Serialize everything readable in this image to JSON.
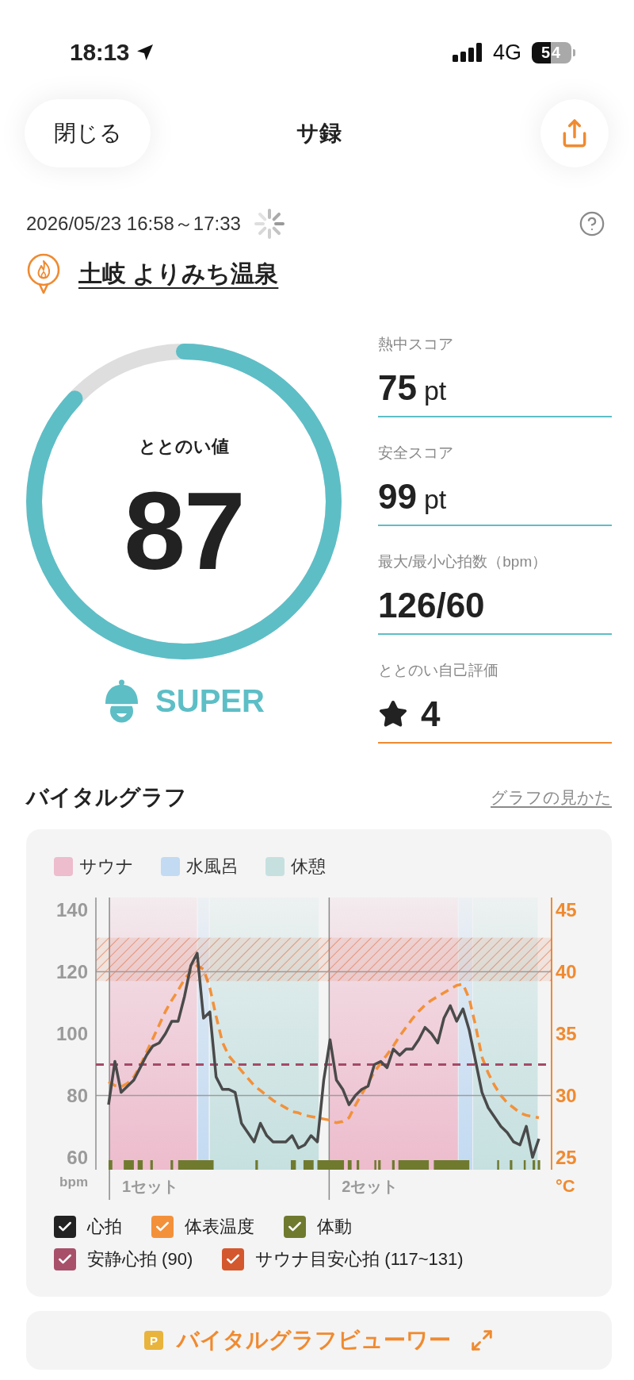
{
  "status_bar": {
    "time": "18:13",
    "network": "4G",
    "battery": "54"
  },
  "header": {
    "close_button": "閉じる",
    "title": "サ録"
  },
  "session": {
    "datetime": "2026/05/23 16:58～17:33",
    "place": "土岐 よりみち温泉"
  },
  "score": {
    "label": "ととのい値",
    "value": "87",
    "level": 0.87,
    "rank": "SUPER"
  },
  "stats": [
    {
      "kind": "metric",
      "label": "熱中スコア",
      "value": "75",
      "unit": "pt"
    },
    {
      "kind": "metric",
      "label": "安全スコア",
      "value": "99",
      "unit": "pt"
    },
    {
      "kind": "metric",
      "label": "最大/最小心拍数（bpm）",
      "value": "126/60"
    },
    {
      "kind": "rating",
      "label": "ととのい自己評価",
      "value": "4"
    }
  ],
  "vital_graph": {
    "title": "バイタルグラフ",
    "help_link": "グラフの見かた",
    "legend": [
      {
        "label": "サウナ",
        "color": "#edbccd"
      },
      {
        "label": "水風呂",
        "color": "#c2daf2"
      },
      {
        "label": "休憩",
        "color": "#c6e0e0"
      }
    ],
    "heart_rate_chart": {
      "chart_data": {
        "type": "line",
        "ylabel": "bpm",
        "ylim": [
          56,
          144
        ],
        "yticks": [
          60,
          80,
          100,
          120,
          140
        ],
        "categories": [
          null,
          null,
          null,
          null,
          null,
          null,
          null,
          null,
          null,
          null,
          null,
          null,
          null,
          null,
          null,
          null,
          null,
          null,
          null,
          null,
          null,
          null,
          null,
          null,
          null,
          null,
          null,
          null,
          null,
          null,
          null,
          null,
          null,
          null,
          null,
          null,
          null,
          null,
          null,
          null,
          null,
          null,
          null,
          null,
          null,
          null,
          null,
          null,
          null,
          null,
          null,
          null,
          null,
          null,
          null,
          null,
          null,
          null,
          null,
          null,
          null,
          null,
          null,
          null,
          null,
          null,
          null,
          null,
          null
        ],
        "series": [
          {
            "color": "#4a4a4a",
            "values": [
              77,
              91,
              81,
              83,
              85,
              89,
              93,
              96,
              97,
              100,
              104,
              104,
              112,
              122,
              126,
              105,
              107,
              86,
              82,
              82,
              81,
              71,
              68,
              65,
              71,
              67,
              65,
              65,
              65,
              67,
              63,
              64,
              67,
              65,
              85,
              98,
              85,
              82,
              77,
              80,
              82,
              83,
              90,
              91,
              89,
              95,
              93,
              95,
              95,
              98,
              102,
              100,
              97,
              105,
              109,
              104,
              108,
              101,
              91,
              81,
              76,
              73,
              70,
              68,
              65,
              64,
              70,
              60,
              66
            ]
          }
        ],
        "ref_lines": [
          {
            "axis": "y",
            "value": 90,
            "color": "#a44a66"
          }
        ],
        "bands": [
          {
            "axis": "y",
            "from": 117,
            "to": 131,
            "color": "#d95f33"
          }
        ]
      }
    },
    "temperature_chart": {
      "chart_data": {
        "type": "line",
        "ylabel": "°C",
        "ylim": [
          24,
          46
        ],
        "yticks": [
          25,
          30,
          35,
          40,
          45
        ],
        "categories": [
          null,
          null,
          null,
          null,
          null,
          null,
          null,
          null,
          null,
          null,
          null,
          null,
          null,
          null,
          null,
          null,
          null,
          null,
          null,
          null,
          null,
          null,
          null,
          null,
          null,
          null,
          null,
          null,
          null,
          null,
          null,
          null,
          null,
          null,
          null,
          null,
          null,
          null,
          null,
          null,
          null,
          null,
          null,
          null,
          null,
          null,
          null,
          null,
          null,
          null,
          null,
          null,
          null,
          null,
          null,
          null,
          null,
          null,
          null,
          null,
          null,
          null,
          null,
          null,
          null,
          null,
          null,
          null,
          null
        ],
        "series": [
          {
            "color": "#f3913a",
            "line_style": "dashed",
            "values": [
              31.1,
              30.8,
              30.7,
              31.0,
              31.5,
              32.4,
              33.5,
              34.6,
              35.7,
              36.8,
              37.7,
              38.5,
              39.4,
              40.0,
              40.5,
              40.2,
              38.7,
              36.4,
              34.3,
              33.2,
              32.6,
              32.0,
              31.4,
              30.8,
              30.4,
              30.0,
              29.6,
              29.3,
              29.0,
              28.7,
              28.6,
              28.4,
              28.3,
              28.2,
              28.1,
              28.0,
              27.8,
              27.9,
              28.2,
              29.2,
              30.1,
              31.0,
              31.9,
              32.6,
              33.3,
              34.0,
              34.8,
              35.5,
              36.2,
              36.8,
              37.3,
              37.7,
              38.0,
              38.3,
              38.6,
              38.9,
              39.0,
              37.8,
              35.6,
              33.1,
              31.8,
              30.8,
              30.0,
              29.4,
              29.0,
              28.6,
              28.4,
              28.3,
              28.2
            ]
          }
        ]
      }
    },
    "sets": [
      {
        "label": "1セット"
      },
      {
        "label": "2セット"
      }
    ],
    "toggles": [
      [
        {
          "label": "心拍",
          "checked": true,
          "color": "#222222"
        },
        {
          "label": "体表温度",
          "checked": true,
          "color": "#f3913a"
        },
        {
          "label": "体動",
          "checked": true,
          "color": "#6f7a2f"
        }
      ],
      [
        {
          "label": "安静心拍 (90)",
          "checked": true,
          "color": "#a8506a"
        },
        {
          "label": "サウナ目安心拍 (117~131)",
          "checked": true,
          "color": "#d4582e"
        }
      ]
    ]
  },
  "viewer_button": {
    "badge": "P",
    "label": "バイタルグラフビューワー"
  }
}
